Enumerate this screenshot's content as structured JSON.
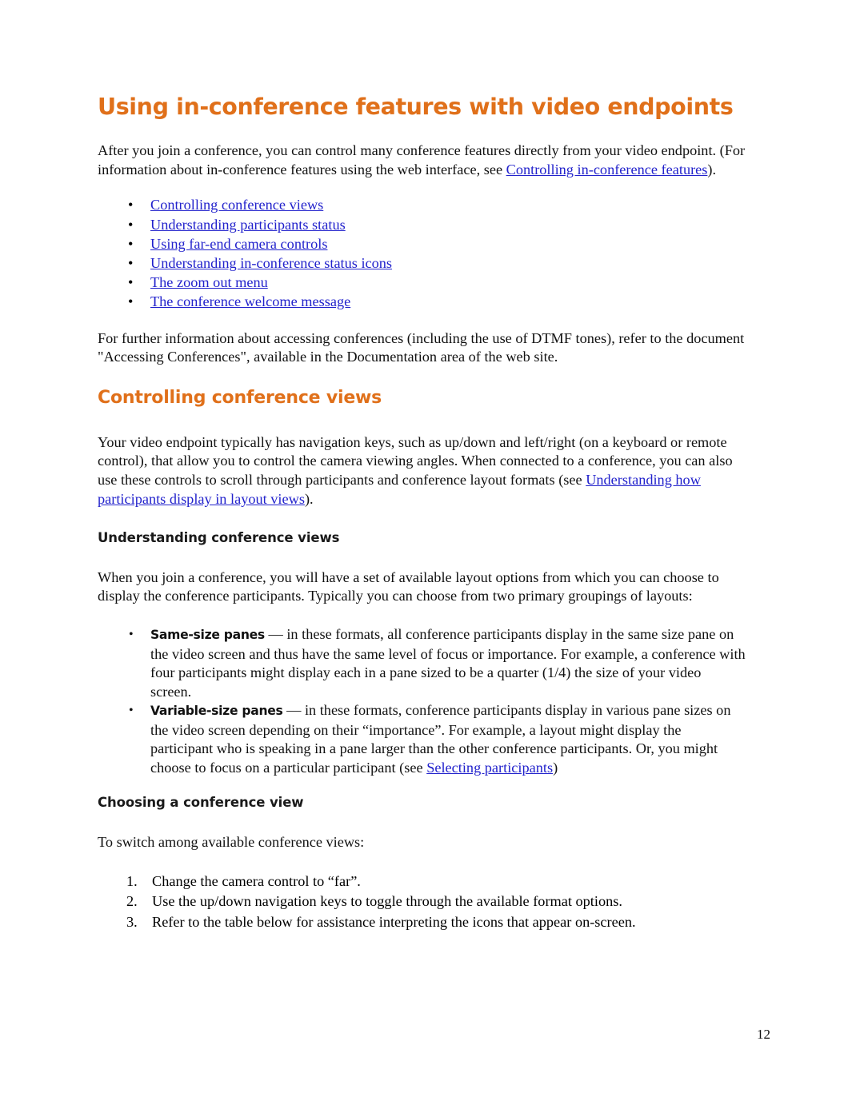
{
  "document": {
    "title": "Using in-conference features with video endpoints",
    "page_number": "12"
  },
  "intro": {
    "text_before_link": "After you join a conference, you can control many conference features directly from your video endpoint. (For information about in-conference features using the web interface, see ",
    "link": "Controlling in-conference features",
    "text_after_link": ")."
  },
  "toc_links": [
    {
      "label": "Controlling conference views",
      "bullet": "•"
    },
    {
      "label": "Understanding participants status",
      "bullet": "•"
    },
    {
      "label": "Using far-end camera controls",
      "bullet": "•"
    },
    {
      "label": "Understanding in-conference status icons",
      "bullet": "•"
    },
    {
      "label": "The zoom out menu",
      "bullet": "•"
    },
    {
      "label": "The conference welcome message",
      "bullet": "•"
    }
  ],
  "further_info": {
    "text": "For further information about accessing conferences (including the use of DTMF tones), refer to the document \"Accessing Conferences\", available in the Documentation area of the web site."
  },
  "section_controlling": {
    "heading": "Controlling conference views",
    "paragraph_before_link": "Your video endpoint typically has navigation keys, such as up/down and left/right (on a keyboard or remote control), that allow you to control the camera viewing angles. When connected to a conference, you can also use these controls to scroll through participants and conference layout formats (see ",
    "paragraph_link": "Understanding how participants display in layout views",
    "paragraph_after_link": ")."
  },
  "section_understanding": {
    "heading": "Understanding conference views",
    "paragraph": "When you join a conference, you will have a set of available layout options from which you can choose to display the conference participants. Typically you can choose from two primary groupings of layouts:"
  },
  "pane_types": [
    {
      "bullet": "•",
      "term": "Same-size panes",
      "dash": " — ",
      "description": "in these formats, all conference participants display in the same size pane on the video screen and thus have the same level of focus or importance. For example, a conference with four participants might display each in a pane sized to be a quarter (1/4) the size of your video screen."
    },
    {
      "bullet": "•",
      "term": "Variable-size panes",
      "dash": " — ",
      "description_before_link": "in these formats, conference participants display in various pane sizes on the video screen depending on their “importance”. For example, a layout might display the participant who is speaking in a pane larger than the other conference participants. Or, you might choose to focus on a particular participant (see ",
      "link": "Selecting participants",
      "description_after_link": ")"
    }
  ],
  "section_choosing": {
    "heading": "Choosing a conference view",
    "intro": "To switch among available conference views:",
    "steps": [
      {
        "num": "1.",
        "text": "Change the camera control to “far”."
      },
      {
        "num": "2.",
        "text": "Use the up/down navigation keys to toggle through the available format options."
      },
      {
        "num": "3.",
        "text": "Refer to the table below for assistance interpreting the icons that appear on-screen."
      }
    ]
  },
  "colors": {
    "heading_orange": "#E0701A",
    "link_blue": "#2222CC",
    "body_text": "#111111"
  }
}
